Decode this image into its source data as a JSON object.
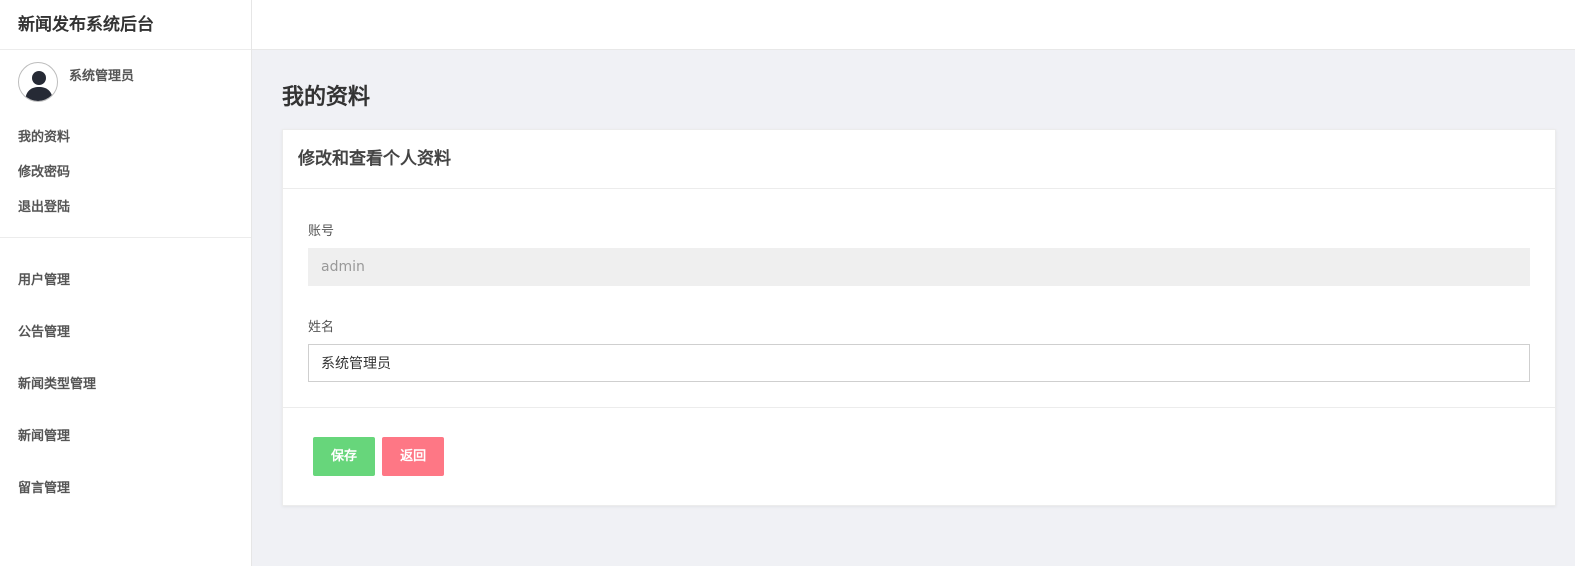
{
  "app": {
    "title": "新闻发布系统后台"
  },
  "user": {
    "name": "系统管理员"
  },
  "profile_links": [
    {
      "label": "我的资料"
    },
    {
      "label": "修改密码"
    },
    {
      "label": "退出登陆"
    }
  ],
  "nav": [
    {
      "label": "用户管理"
    },
    {
      "label": "公告管理"
    },
    {
      "label": "新闻类型管理"
    },
    {
      "label": "新闻管理"
    },
    {
      "label": "留言管理"
    }
  ],
  "page": {
    "title": "我的资料"
  },
  "card": {
    "title": "修改和查看个人资料",
    "account": {
      "label": "账号",
      "value": "admin"
    },
    "name": {
      "label": "姓名",
      "value": "系统管理员"
    }
  },
  "buttons": {
    "save": "保存",
    "back": "返回"
  },
  "colors": {
    "save_button": "#67d67b",
    "back_button": "#fe7785",
    "background": "#f0f1f5"
  }
}
